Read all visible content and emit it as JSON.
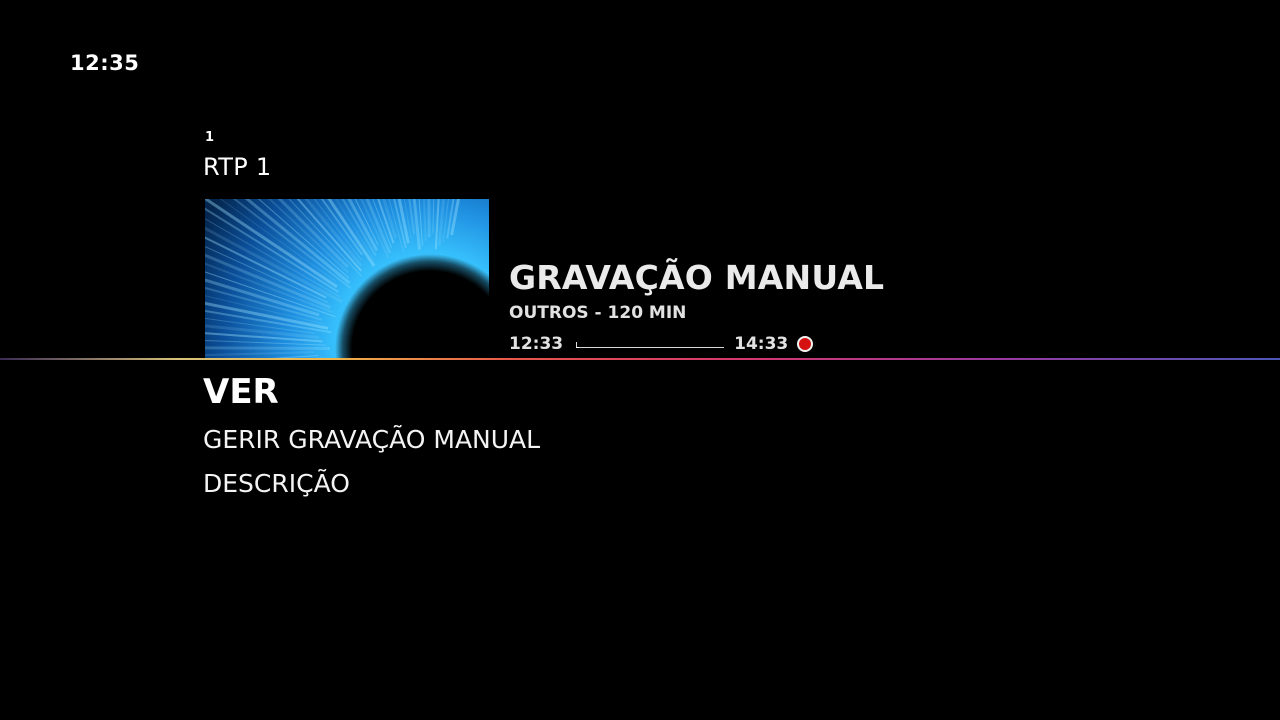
{
  "clock": "12:35",
  "channel": {
    "number": "1",
    "name": "RTP 1"
  },
  "program": {
    "title": "GRAVAÇÃO MANUAL",
    "meta": "OUTROS - 120 MIN",
    "start_time": "12:33",
    "end_time": "14:33",
    "progress_fraction": 0.02,
    "recording": true
  },
  "menu": {
    "items": [
      {
        "label": "VER",
        "selected": true
      },
      {
        "label": "GERIR GRAVAÇÃO MANUAL",
        "selected": false
      },
      {
        "label": "DESCRIÇÃO",
        "selected": false
      }
    ]
  },
  "colors": {
    "background": "#000000",
    "recording_indicator": "#d41010",
    "text": "#ffffff"
  },
  "icons": {
    "recording": "recording-dot-icon"
  }
}
